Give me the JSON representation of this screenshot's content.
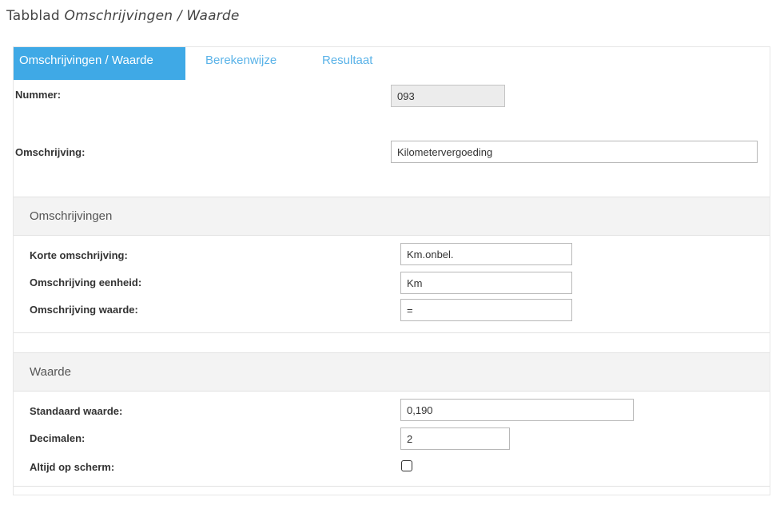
{
  "caption": {
    "prefix": "Tabblad ",
    "italic": "Omschrijvingen / Waarde"
  },
  "tabs": [
    {
      "label": "Omschrijvingen / Waarde",
      "active": true
    },
    {
      "label": "Berekenwijze",
      "active": false
    },
    {
      "label": "Resultaat",
      "active": false
    }
  ],
  "general": {
    "nummer": {
      "label": "Nummer:",
      "value": "093",
      "readonly": true
    },
    "omschrijving": {
      "label": "Omschrijving:",
      "value": "Kilometervergoeding"
    }
  },
  "section_omschrijvingen": {
    "title": "Omschrijvingen",
    "korte": {
      "label": "Korte omschrijving:",
      "value": "Km.onbel."
    },
    "eenheid": {
      "label": "Omschrijving eenheid:",
      "value": "Km"
    },
    "waarde": {
      "label": "Omschrijving waarde:",
      "value": "="
    }
  },
  "section_waarde": {
    "title": "Waarde",
    "standaard": {
      "label": "Standaard waarde:",
      "value": "0,190"
    },
    "decimalen": {
      "label": "Decimalen:",
      "value": "2"
    },
    "altijd": {
      "label": "Altijd op scherm:",
      "checked": false
    }
  },
  "colors": {
    "accent": "#3fa9e6",
    "tab_link": "#5bb3e8",
    "section_bg": "#f3f3f3"
  }
}
